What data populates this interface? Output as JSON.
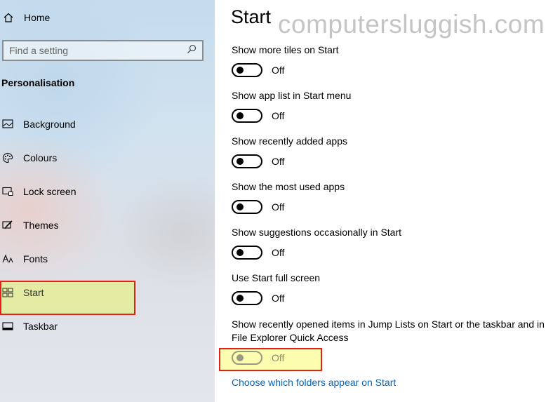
{
  "sidebar": {
    "home": {
      "label": "Home",
      "icon": "home-icon"
    },
    "search": {
      "placeholder": "Find a setting",
      "icon": "search-icon"
    },
    "section_title": "Personalisation",
    "items": [
      {
        "label": "Background",
        "icon": "picture-icon"
      },
      {
        "label": "Colours",
        "icon": "palette-icon"
      },
      {
        "label": "Lock screen",
        "icon": "lock-screen-icon"
      },
      {
        "label": "Themes",
        "icon": "themes-brush-icon"
      },
      {
        "label": "Fonts",
        "icon": "fonts-icon"
      },
      {
        "label": "Start",
        "icon": "start-tiles-icon",
        "selected": true
      },
      {
        "label": "Taskbar",
        "icon": "taskbar-icon"
      }
    ]
  },
  "main": {
    "title": "Start",
    "watermark": "computersluggish.com",
    "settings": [
      {
        "label": "Show more tiles on Start",
        "state": "Off"
      },
      {
        "label": "Show app list in Start menu",
        "state": "Off"
      },
      {
        "label": "Show recently added apps",
        "state": "Off"
      },
      {
        "label": "Show the most used apps",
        "state": "Off"
      },
      {
        "label": "Show suggestions occasionally in Start",
        "state": "Off"
      },
      {
        "label": "Use Start full screen",
        "state": "Off"
      }
    ],
    "jump_list": {
      "label_line1": "Show recently opened items in Jump Lists on Start or the taskbar and in",
      "label_line2": "File Explorer Quick Access",
      "state": "Off"
    },
    "link": "Choose which folders appear on Start"
  },
  "colors": {
    "highlight_border": "#e51e1e",
    "highlight_fill": "#e6ee8c",
    "link": "#0067c0"
  }
}
